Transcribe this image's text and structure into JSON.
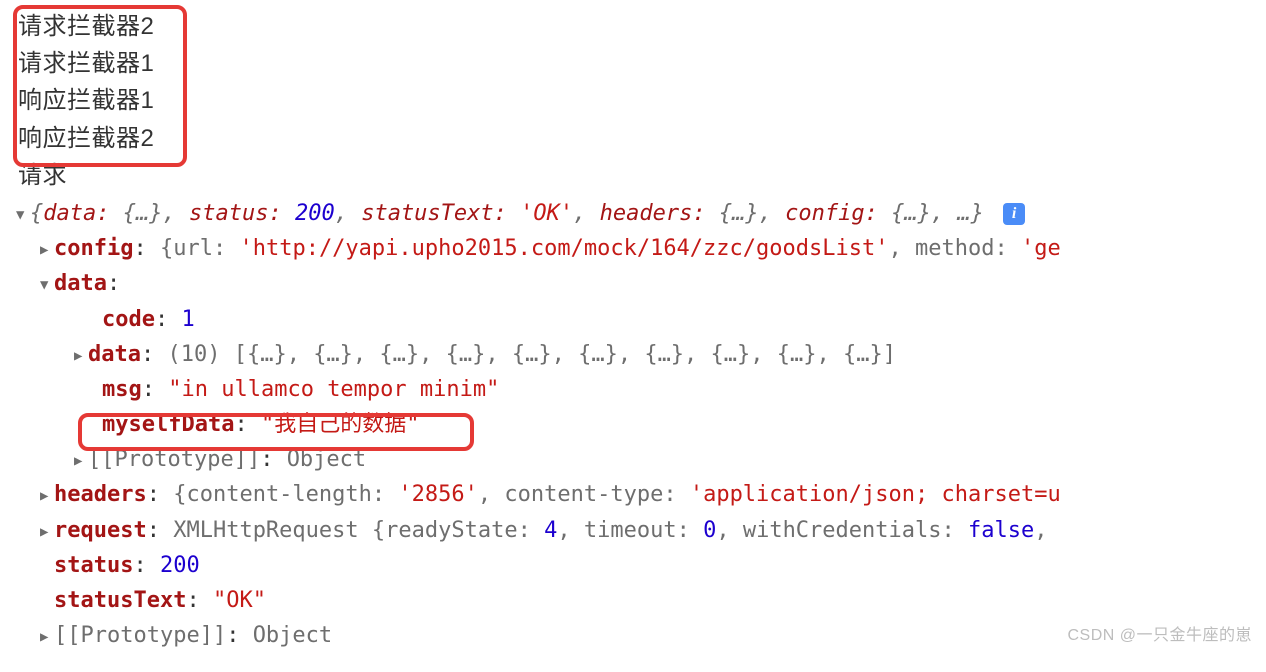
{
  "logs": {
    "line1": "请求拦截器2",
    "line2": "请求拦截器1",
    "line3": "响应拦截器1",
    "line4": "响应拦截器2",
    "line5": "请求"
  },
  "summary": {
    "open": "{",
    "dataKey": "data:",
    "dataVal": "{…}",
    "c1": ",",
    "statusKey": "status:",
    "statusVal": "200",
    "c2": ",",
    "statusTextKey": "statusText:",
    "statusTextVal": "'OK'",
    "c3": ",",
    "headersKey": "headers:",
    "headersVal": "{…}",
    "c4": ",",
    "configKey": "config:",
    "configVal": "{…}",
    "c5": ",",
    "rest": "…}",
    "infoGlyph": "i"
  },
  "config": {
    "key": "config",
    "colon": ":",
    "urlKey": "url:",
    "urlVal": "'http://yapi.upho2015.com/mock/164/zzc/goodsList'",
    "comma": ",",
    "methodKey": "method:",
    "methodVal": "'ge"
  },
  "data": {
    "key": "data",
    "colon": ":",
    "code": {
      "key": "code",
      "colon": ":",
      "val": "1"
    },
    "inner": {
      "key": "data",
      "colon": ":",
      "count": "(10)",
      "arr": "[{…}, {…}, {…}, {…}, {…}, {…}, {…}, {…}, {…}, {…}]"
    },
    "msg": {
      "key": "msg",
      "colon": ":",
      "val": "\"in ullamco tempor minim\""
    },
    "myself": {
      "key": "myselfData",
      "colon": ":",
      "val": "\"我自己的数据\""
    },
    "proto": {
      "key": "[[Prototype]]",
      "colon": ":",
      "val": "Object"
    }
  },
  "headers": {
    "key": "headers",
    "colon": ":",
    "clKey": "content-length:",
    "clVal": "'2856'",
    "comma": ",",
    "ctKey": "content-type:",
    "ctVal": "'application/json; charset=u"
  },
  "request": {
    "key": "request",
    "colon": ":",
    "cls": "XMLHttpRequest",
    "rsKey": "readyState:",
    "rsVal": "4",
    "c1": ",",
    "toKey": "timeout:",
    "toVal": "0",
    "c2": ",",
    "wcKey": "withCredentials:",
    "wcVal": "false",
    "c3": ","
  },
  "status": {
    "key": "status",
    "colon": ":",
    "val": "200"
  },
  "statusText": {
    "key": "statusText",
    "colon": ":",
    "val": "\"OK\""
  },
  "rootProto": {
    "key": "[[Prototype]]",
    "colon": ":",
    "val": "Object"
  },
  "watermark": "CSDN @一只金牛座的崽",
  "glyph": {
    "right": "▶",
    "down": "▼"
  }
}
